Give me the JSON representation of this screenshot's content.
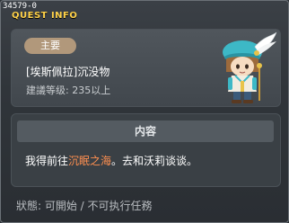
{
  "window": {
    "id": "34579-0",
    "title": "QUEST INFO"
  },
  "quest": {
    "category_badge": "主要",
    "name": "[埃斯佩拉]沉没物",
    "level_requirement": "建議等级: 235以上"
  },
  "content": {
    "header": "内容",
    "text_before": "我得前往",
    "location": "沉眠之海",
    "text_after": "。去和沃莉谈谈。"
  },
  "status": {
    "text": "狀態: 可開始 / 不可执行任務"
  },
  "colors": {
    "title": "#ffd24a",
    "badge": "#b1987b",
    "highlight": "#ff8f50",
    "panel": "#3a4045"
  },
  "icons": {
    "npc": "npc-portrait-icon"
  }
}
